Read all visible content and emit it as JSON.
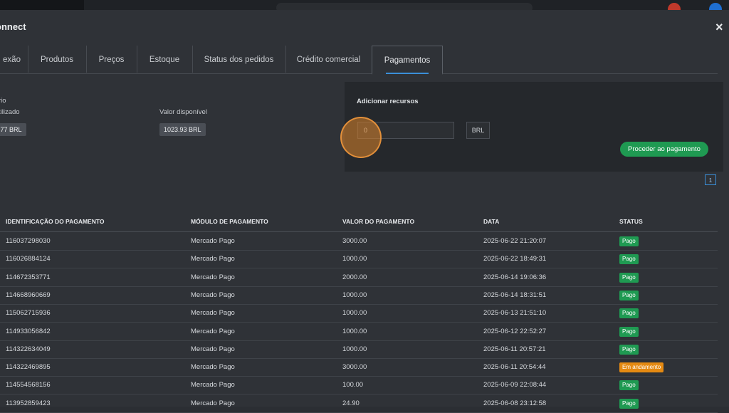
{
  "modal": {
    "title": "onnect",
    "close_label": "×"
  },
  "tabs": [
    {
      "label": "exão"
    },
    {
      "label": "Produtos"
    },
    {
      "label": "Preços"
    },
    {
      "label": "Estoque"
    },
    {
      "label": "Status dos pedidos"
    },
    {
      "label": "Crédito comercial"
    },
    {
      "label": "Pagamentos",
      "active": true
    }
  ],
  "balance": {
    "group_label": "rio",
    "used_label": "tilizado",
    "used_value": ".77 BRL",
    "available_label": "Valor disponível",
    "available_value": "1023.93 BRL"
  },
  "add_funds": {
    "title": "Adicionar recursos",
    "amount_value": "0",
    "currency": "BRL",
    "proceed_label": "Proceder ao pagamento"
  },
  "pagination": {
    "current_page": "1"
  },
  "table": {
    "headers": [
      "IDENTIFICAÇÃO DO PAGAMENTO",
      "MÓDULO DE PAGAMENTO",
      "VALOR DO PAGAMENTO",
      "DATA",
      "STATUS"
    ],
    "rows": [
      {
        "id": "116037298030",
        "module": "Mercado Pago",
        "amount": "3000.00",
        "date": "2025-06-22 21:20:07",
        "status": "Pago"
      },
      {
        "id": "116026884124",
        "module": "Mercado Pago",
        "amount": "1000.00",
        "date": "2025-06-22 18:49:31",
        "status": "Pago"
      },
      {
        "id": "114672353771",
        "module": "Mercado Pago",
        "amount": "2000.00",
        "date": "2025-06-14 19:06:36",
        "status": "Pago"
      },
      {
        "id": "114668960669",
        "module": "Mercado Pago",
        "amount": "1000.00",
        "date": "2025-06-14 18:31:51",
        "status": "Pago"
      },
      {
        "id": "115062715936",
        "module": "Mercado Pago",
        "amount": "1000.00",
        "date": "2025-06-13 21:51:10",
        "status": "Pago"
      },
      {
        "id": "114933056842",
        "module": "Mercado Pago",
        "amount": "1000.00",
        "date": "2025-06-12 22:52:27",
        "status": "Pago"
      },
      {
        "id": "114322634049",
        "module": "Mercado Pago",
        "amount": "1000.00",
        "date": "2025-06-11 20:57:21",
        "status": "Pago"
      },
      {
        "id": "114322469895",
        "module": "Mercado Pago",
        "amount": "3000.00",
        "date": "2025-06-11 20:54:44",
        "status": "Em andamento"
      },
      {
        "id": "114554568156",
        "module": "Mercado Pago",
        "amount": "100.00",
        "date": "2025-06-09 22:08:44",
        "status": "Pago"
      },
      {
        "id": "113952859423",
        "module": "Mercado Pago",
        "amount": "24.90",
        "date": "2025-06-08 23:12:58",
        "status": "Pago"
      }
    ]
  },
  "colors": {
    "accent": "#3b8fd9",
    "success": "#1f9a52",
    "warning": "#e58a12",
    "highlight": "#dd842a"
  },
  "icons": [
    "close-icon"
  ]
}
